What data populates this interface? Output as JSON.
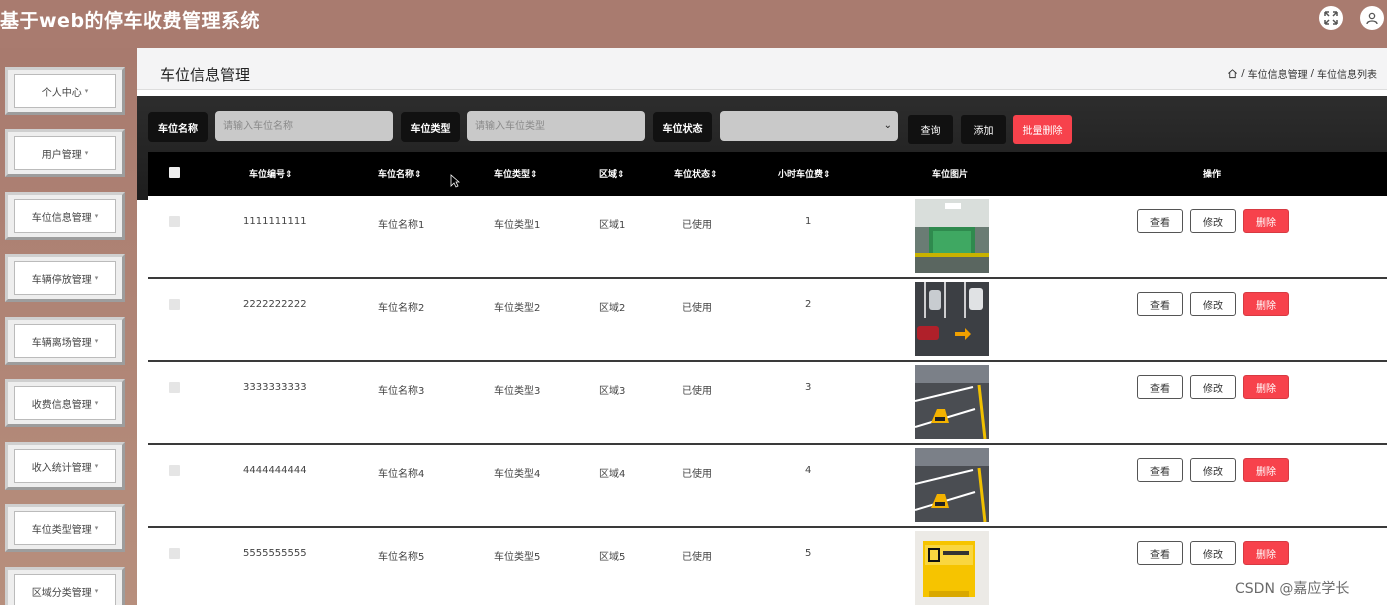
{
  "header": {
    "title": "基于web的停车收费管理系统",
    "icons": [
      "fullscreen-icon",
      "user-icon"
    ]
  },
  "sidebar": {
    "items": [
      {
        "label": "个人中心"
      },
      {
        "label": "用户管理"
      },
      {
        "label": "车位信息管理"
      },
      {
        "label": "车辆停放管理"
      },
      {
        "label": "车辆离场管理"
      },
      {
        "label": "收费信息管理"
      },
      {
        "label": "收入统计管理"
      },
      {
        "label": "车位类型管理"
      },
      {
        "label": "区域分类管理"
      }
    ],
    "caret": "▾"
  },
  "page": {
    "title": "车位信息管理",
    "breadcrumb": [
      "车位信息管理",
      "车位信息列表"
    ],
    "breadcrumb_sep": "/"
  },
  "search": {
    "name_label": "车位名称",
    "name_placeholder": "请输入车位名称",
    "type_label": "车位类型",
    "type_placeholder": "请输入车位类型",
    "status_label": "车位状态",
    "status_value": "",
    "query_button": "查询",
    "add_button": "添加",
    "batch_delete_button": "批量删除"
  },
  "table": {
    "columns": [
      "车位编号",
      "车位名称",
      "车位类型",
      "区域",
      "车位状态",
      "小时车位费",
      "车位图片",
      "操作"
    ],
    "sort_mark": "⇕",
    "rows": [
      {
        "code": "1111111111",
        "name": "车位名称1",
        "type": "车位类型1",
        "area": "区域1",
        "status": "已使用",
        "fee": "1",
        "image": "underground-parking-photo"
      },
      {
        "code": "2222222222",
        "name": "车位名称2",
        "type": "车位类型2",
        "area": "区域2",
        "status": "已使用",
        "fee": "2",
        "image": "parking-lot-cars-photo"
      },
      {
        "code": "3333333333",
        "name": "车位名称3",
        "type": "车位类型3",
        "area": "区域3",
        "status": "已使用",
        "fee": "3",
        "image": "parking-lock-photo"
      },
      {
        "code": "4444444444",
        "name": "车位名称4",
        "type": "车位类型4",
        "area": "区域4",
        "status": "已使用",
        "fee": "4",
        "image": "parking-lock-photo"
      },
      {
        "code": "5555555555",
        "name": "车位名称5",
        "type": "车位类型5",
        "area": "区域5",
        "status": "已使用",
        "fee": "5",
        "image": "reserved-parking-sign-photo"
      }
    ],
    "row_actions": {
      "view": "查看",
      "edit": "修改",
      "delete": "删除"
    }
  },
  "watermark": "CSDN @嘉应学长",
  "colors": {
    "header_bg": "#a97b6f",
    "search_bg": "#1d1d1d",
    "danger": "#f7424c"
  }
}
